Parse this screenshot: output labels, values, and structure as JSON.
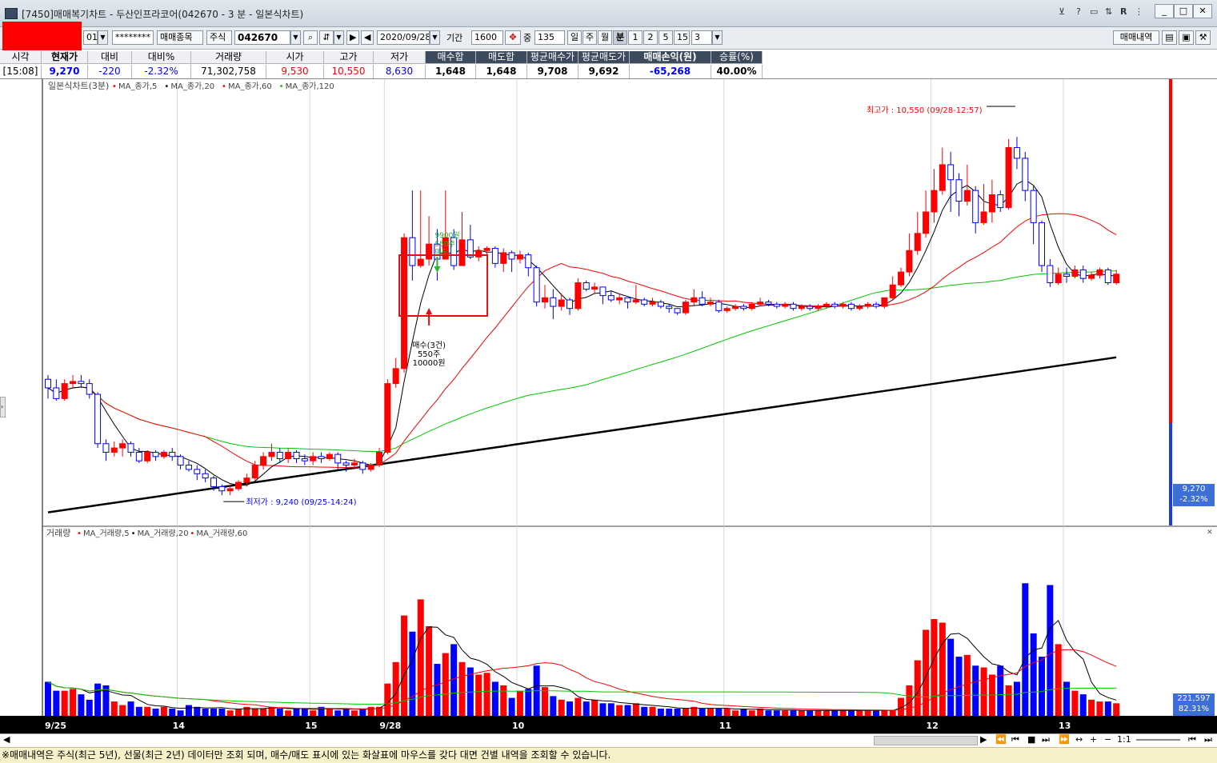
{
  "window": {
    "title": "[7450]매매복기차트 - 두산인프라코어(042670 - 3 분 - 일본식차트)",
    "controls": [
      "minimize",
      "maximize",
      "close"
    ]
  },
  "toolbar": {
    "account_suffix": "01",
    "password_mask": "********",
    "trade_items_button": "매매종목",
    "market_select": "주식",
    "stock_code": "042670",
    "date": "2020/09/28",
    "period_label": "기간",
    "period_value": "1600",
    "count_label": "중",
    "count_value": "135",
    "period_buttons": [
      "일",
      "주",
      "월",
      "분",
      "1",
      "2",
      "5",
      "15"
    ],
    "active_period": "분",
    "minute_value": "3",
    "trade_history_button": "매매내역"
  },
  "info": {
    "headers": [
      "시각",
      "현재가",
      "대비",
      "대비%",
      "거래량",
      "시가",
      "고가",
      "저가",
      "매수합",
      "매도합",
      "평균매수가",
      "평균매도가",
      "매매손익(원)",
      "승률(%)"
    ],
    "values": [
      "[15:08]",
      "9,270",
      "-220",
      "-2.32%",
      "71,302,758",
      "9,530",
      "10,550",
      "8,630",
      "1,648",
      "1,648",
      "9,708",
      "9,692",
      "-65,268",
      "40.00%"
    ]
  },
  "price_legend": {
    "title": "일본식차트(3분)",
    "ma": [
      "MA_종가,5",
      "MA_종가,20",
      "MA_종가,60",
      "MA_종가,120"
    ]
  },
  "volume_legend": {
    "title": "거래량",
    "ma": [
      "MA_거래량,5",
      "MA_거래량,20",
      "MA_거래량,60"
    ]
  },
  "annotations": {
    "high": "최고가 : 10,550 (09/28-12:57)",
    "low": "최저가 : 9,240 (09/25-14:24)",
    "buy_line1": "매수(3건)",
    "buy_line2": "550주",
    "buy_line3": "10000원",
    "sell_line1": "9900원",
    "sell_line2": "550주",
    "sell_line3": "매도"
  },
  "price_axis": {
    "current_price": "9,270",
    "current_change": "-2.32%"
  },
  "volume_axis": {
    "current_volume": "221,597",
    "current_ratio": "82.31%"
  },
  "x_axis_labels": [
    "9/25",
    "14",
    "15",
    "9/28",
    "10",
    "11",
    "12",
    "13"
  ],
  "status_bar": {
    "zoom": "1:1"
  },
  "notice": "※매매내역은 주식(최근 5년), 선물(최근 2년) 데이터만 조회 되며, 매수/매도 표시에 있는 화살표에 마우스를 갖다 대면 건별 내역을 조회할 수 있습니다.",
  "colors": {
    "up": "#ff0000",
    "down": "#0000ff",
    "ma5": "#000000",
    "ma20": "#ff0000",
    "ma60": "#00c800",
    "ma120": "#000000"
  },
  "chart_data": {
    "type": "candlestick",
    "interval": "3분",
    "ylim": [
      8750,
      10800
    ],
    "volume_ylim": [
      0,
      1000
    ],
    "candles_ohlc": [
      [
        9420,
        9380,
        9440,
        9330
      ],
      [
        9380,
        9330,
        9420,
        9320
      ],
      [
        9330,
        9400,
        9420,
        9320
      ],
      [
        9400,
        9410,
        9440,
        9380
      ],
      [
        9410,
        9400,
        9440,
        9380
      ],
      [
        9400,
        9350,
        9420,
        9330
      ],
      [
        9350,
        9120,
        9360,
        9100
      ],
      [
        9120,
        9080,
        9140,
        9040
      ],
      [
        9080,
        9100,
        9130,
        9060
      ],
      [
        9100,
        9120,
        9140,
        9060
      ],
      [
        9120,
        9080,
        9130,
        9060
      ],
      [
        9080,
        9040,
        9100,
        9030
      ],
      [
        9040,
        9080,
        9090,
        9030
      ],
      [
        9080,
        9060,
        9090,
        9040
      ],
      [
        9060,
        9080,
        9090,
        9050
      ],
      [
        9080,
        9060,
        9100,
        9040
      ],
      [
        9060,
        9020,
        9070,
        9000
      ],
      [
        9020,
        9000,
        9040,
        8990
      ],
      [
        9000,
        8980,
        9020,
        8950
      ],
      [
        8980,
        8960,
        9000,
        8940
      ],
      [
        8960,
        8920,
        8970,
        8900
      ],
      [
        8920,
        8900,
        8930,
        8880
      ],
      [
        8900,
        8910,
        8930,
        8880
      ],
      [
        8910,
        8940,
        8950,
        8900
      ],
      [
        8940,
        8960,
        8980,
        8920
      ],
      [
        8960,
        9020,
        9040,
        8950
      ],
      [
        9020,
        9060,
        9080,
        9000
      ],
      [
        9060,
        9080,
        9120,
        9040
      ],
      [
        9080,
        9050,
        9100,
        9030
      ],
      [
        9050,
        9080,
        9100,
        9030
      ],
      [
        9080,
        9050,
        9090,
        9030
      ],
      [
        9050,
        9040,
        9070,
        9020
      ],
      [
        9040,
        9060,
        9080,
        9020
      ],
      [
        9060,
        9050,
        9080,
        9030
      ],
      [
        9050,
        9070,
        9080,
        9040
      ],
      [
        9070,
        9030,
        9080,
        9000
      ],
      [
        9030,
        9020,
        9040,
        8990
      ],
      [
        9020,
        9030,
        9050,
        9000
      ],
      [
        9030,
        9000,
        9040,
        8980
      ],
      [
        9000,
        9020,
        9030,
        8990
      ],
      [
        9020,
        9080,
        9100,
        9010
      ],
      [
        9080,
        9400,
        9420,
        9070
      ],
      [
        9400,
        9470,
        9520,
        9380
      ],
      [
        9470,
        10080,
        10100,
        9450
      ],
      [
        10080,
        9950,
        10300,
        9880
      ],
      [
        9950,
        9980,
        10300,
        9940
      ],
      [
        9980,
        10050,
        10180,
        9950
      ],
      [
        10050,
        9980,
        10120,
        9880
      ],
      [
        9980,
        10080,
        10300,
        10000
      ],
      [
        10080,
        9950,
        10120,
        9930
      ],
      [
        9950,
        10070,
        10200,
        9950
      ],
      [
        10070,
        9990,
        10140,
        9980
      ],
      [
        9990,
        10020,
        10040,
        9970
      ],
      [
        10020,
        10030,
        10040,
        10000
      ],
      [
        10030,
        9960,
        10040,
        9940
      ],
      [
        9960,
        10010,
        10030,
        9920
      ],
      [
        10010,
        9980,
        10020,
        9920
      ],
      [
        9980,
        10000,
        10020,
        9960
      ],
      [
        10000,
        9940,
        10010,
        9900
      ],
      [
        9940,
        9780,
        9950,
        9760
      ],
      [
        9780,
        9800,
        9860,
        9750
      ],
      [
        9800,
        9760,
        9840,
        9700
      ],
      [
        9760,
        9790,
        9820,
        9740
      ],
      [
        9790,
        9750,
        9800,
        9720
      ],
      [
        9750,
        9870,
        9890,
        9740
      ],
      [
        9870,
        9840,
        9880,
        9830
      ],
      [
        9840,
        9850,
        9870,
        9820
      ],
      [
        9850,
        9810,
        9850,
        9770
      ],
      [
        9810,
        9790,
        9830,
        9780
      ],
      [
        9790,
        9800,
        9820,
        9770
      ],
      [
        9800,
        9780,
        9800,
        9750
      ],
      [
        9780,
        9790,
        9860,
        9770
      ],
      [
        9790,
        9770,
        9800,
        9760
      ],
      [
        9770,
        9780,
        9800,
        9760
      ],
      [
        9780,
        9760,
        9790,
        9750
      ],
      [
        9760,
        9750,
        9770,
        9730
      ],
      [
        9750,
        9730,
        9750,
        9720
      ],
      [
        9730,
        9780,
        9790,
        9720
      ],
      [
        9780,
        9800,
        9840,
        9760
      ],
      [
        9800,
        9770,
        9830,
        9760
      ],
      [
        9770,
        9780,
        9800,
        9760
      ],
      [
        9780,
        9740,
        9790,
        9730
      ],
      [
        9740,
        9750,
        9760,
        9730
      ],
      [
        9750,
        9760,
        9770,
        9740
      ],
      [
        9760,
        9750,
        9770,
        9740
      ],
      [
        9750,
        9770,
        9780,
        9740
      ],
      [
        9770,
        9780,
        9800,
        9760
      ],
      [
        9780,
        9770,
        9790,
        9760
      ],
      [
        9770,
        9760,
        9780,
        9750
      ],
      [
        9760,
        9770,
        9780,
        9750
      ],
      [
        9770,
        9750,
        9780,
        9740
      ],
      [
        9750,
        9760,
        9770,
        9740
      ],
      [
        9760,
        9750,
        9770,
        9740
      ],
      [
        9750,
        9760,
        9770,
        9740
      ],
      [
        9760,
        9770,
        9780,
        9750
      ],
      [
        9770,
        9760,
        9780,
        9750
      ],
      [
        9760,
        9770,
        9780,
        9750
      ],
      [
        9770,
        9750,
        9780,
        9740
      ],
      [
        9750,
        9760,
        9770,
        9740
      ],
      [
        9760,
        9770,
        9780,
        9750
      ],
      [
        9770,
        9760,
        9780,
        9750
      ],
      [
        9760,
        9800,
        9800,
        9750
      ],
      [
        9800,
        9860,
        9900,
        9790
      ],
      [
        9860,
        9920,
        9940,
        9850
      ],
      [
        9920,
        10020,
        10100,
        9900
      ],
      [
        10020,
        10100,
        10200,
        10000
      ],
      [
        10100,
        10200,
        10300,
        10080
      ],
      [
        10200,
        10300,
        10400,
        10150
      ],
      [
        10300,
        10420,
        10500,
        10280
      ],
      [
        10420,
        10350,
        10480,
        10200
      ],
      [
        10350,
        10250,
        10380,
        10180
      ],
      [
        10250,
        10300,
        10420,
        10230
      ],
      [
        10300,
        10150,
        10320,
        10100
      ],
      [
        10150,
        10200,
        10330,
        10140
      ],
      [
        10200,
        10280,
        10350,
        10150
      ],
      [
        10280,
        10220,
        10300,
        10200
      ],
      [
        10220,
        10500,
        10540,
        10210
      ],
      [
        10500,
        10450,
        10550,
        10400
      ],
      [
        10450,
        10300,
        10480,
        10250
      ],
      [
        10300,
        10150,
        10320,
        10050
      ],
      [
        10150,
        9950,
        10160,
        9920
      ],
      [
        9950,
        9870,
        9980,
        9850
      ],
      [
        9870,
        9910,
        9940,
        9860
      ],
      [
        9910,
        9900,
        9940,
        9870
      ],
      [
        9900,
        9930,
        9950,
        9890
      ],
      [
        9930,
        9890,
        9950,
        9870
      ],
      [
        9890,
        9905,
        9920,
        9880
      ],
      [
        9905,
        9930,
        9940,
        9890
      ],
      [
        9930,
        9870,
        9940,
        9860
      ],
      [
        9870,
        9910,
        9930,
        9860
      ]
    ],
    "volume": [
      190,
      140,
      140,
      150,
      120,
      90,
      180,
      170,
      80,
      60,
      80,
      50,
      50,
      40,
      50,
      40,
      30,
      60,
      50,
      40,
      40,
      40,
      30,
      40,
      50,
      40,
      40,
      50,
      40,
      30,
      40,
      40,
      30,
      50,
      40,
      30,
      40,
      30,
      40,
      50,
      50,
      180,
      300,
      560,
      470,
      650,
      500,
      290,
      350,
      400,
      300,
      270,
      230,
      240,
      190,
      170,
      100,
      140,
      150,
      280,
      160,
      110,
      90,
      80,
      100,
      80,
      90,
      70,
      70,
      60,
      60,
      70,
      50,
      50,
      40,
      40,
      40,
      40,
      50,
      40,
      40,
      40,
      40,
      30,
      40,
      30,
      40,
      30,
      30,
      30,
      30,
      30,
      30,
      30,
      30,
      30,
      30,
      30,
      30,
      30,
      30,
      30,
      30,
      100,
      170,
      310,
      480,
      540,
      520,
      430,
      330,
      340,
      280,
      270,
      230,
      280,
      170,
      190,
      740,
      460,
      330,
      730,
      400,
      190,
      140,
      120,
      90,
      80,
      80,
      70
    ],
    "buy_marker_index": 48,
    "sell_marker_index": 51,
    "x_label_indices": [
      0,
      16,
      32,
      41,
      57,
      82,
      107,
      123
    ]
  }
}
